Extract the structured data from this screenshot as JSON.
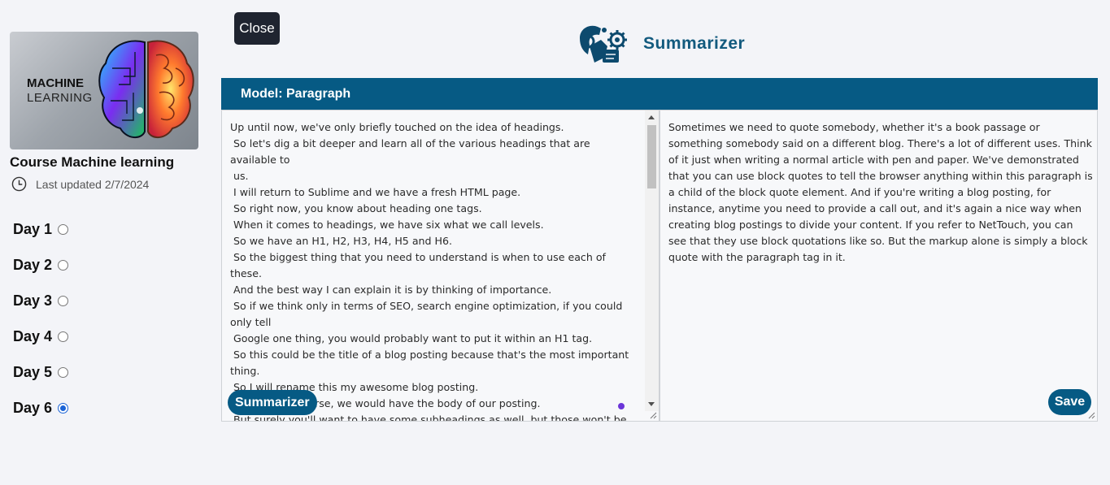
{
  "sidebar": {
    "course_image": {
      "line1": "MACHINE",
      "line2": "LEARNING"
    },
    "course_title": "Course Machine learning",
    "last_updated": "Last updated 2/7/2024",
    "days": [
      {
        "label": "Day 1",
        "selected": false
      },
      {
        "label": "Day 2",
        "selected": false
      },
      {
        "label": "Day 3",
        "selected": false
      },
      {
        "label": "Day 4",
        "selected": false
      },
      {
        "label": "Day 5",
        "selected": false
      },
      {
        "label": "Day 6",
        "selected": true
      }
    ]
  },
  "header": {
    "close_label": "Close",
    "title": "Summarizer"
  },
  "panel": {
    "model_label": "Model: Paragraph",
    "input_text": "Up until now, we've only briefly touched on the idea of headings.\n So let's dig a bit deeper and learn all of the various headings that are available to\n us.\n I will return to Sublime and we have a fresh HTML page.\n So right now, you know about heading one tags.\n When it comes to headings, we have six what we call levels.\n So we have an H1, H2, H3, H4, H5 and H6.\n So the biggest thing that you need to understand is when to use each of these.\n And the best way I can explain it is by thinking of importance.\n So if we think only in terms of SEO, search engine optimization, if you could only tell\n Google one thing, you would probably want to put it within an H1 tag.\n So this could be the title of a blog posting because that's the most important thing.\n So I will rename this my awesome blog posting.\n And then of course, we would have the body of our posting.\n But surely you'll want to have some subheadings as well, but those won't be",
    "summarize_label": "Summarizer",
    "output_text": "Sometimes we need to quote somebody, whether it's a book passage or something somebody said on a different blog. There's a lot of different uses. Think of it just when writing a normal article with pen and paper. We've demonstrated that you can use block quotes to tell the browser anything within this paragraph is a child of the block quote element. And if you're writing a blog posting, for instance, anytime you need to provide a call out, and it's again a nice way when creating blog postings to divide your content. If you refer to NetTouch, you can see that they use block quotations like so. But the markup alone is simply a block quote with the paragraph tag in it.",
    "save_label": "Save"
  },
  "colors": {
    "accent": "#065a84",
    "title": "#125a7e",
    "close_button": "#1f2430",
    "radio_selected": "#1a63d6"
  },
  "icons": [
    "clock-icon",
    "brain-image",
    "robot-gear-logo",
    "resize-handle-icon"
  ]
}
